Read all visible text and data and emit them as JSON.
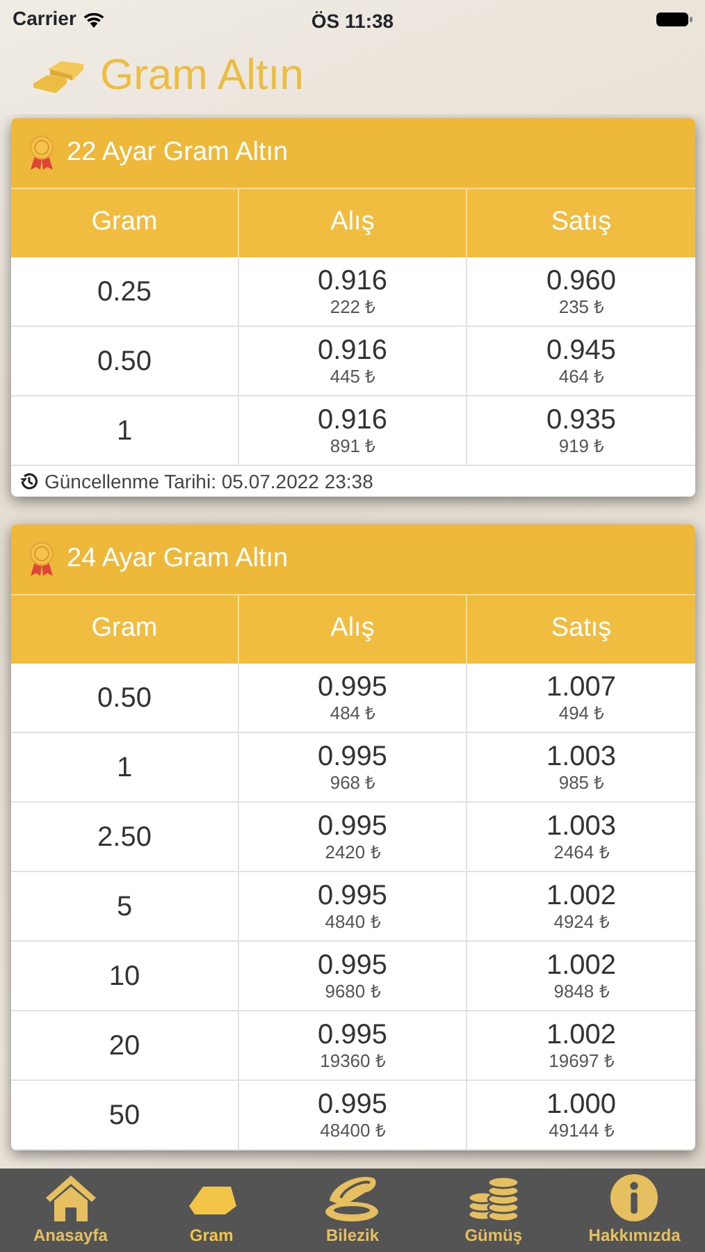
{
  "status_bar": {
    "carrier": "Carrier",
    "time": "ÖS 11:38"
  },
  "title": "Gram Altın",
  "tables": [
    {
      "title": "22 Ayar Gram Altın",
      "columns": [
        "Gram",
        "Alış",
        "Satış"
      ],
      "rows": [
        {
          "gram": "0.25",
          "buy": "0.916",
          "buy_price": "222 ₺",
          "sell": "0.960",
          "sell_price": "235 ₺"
        },
        {
          "gram": "0.50",
          "buy": "0.916",
          "buy_price": "445 ₺",
          "sell": "0.945",
          "sell_price": "464 ₺"
        },
        {
          "gram": "1",
          "buy": "0.916",
          "buy_price": "891 ₺",
          "sell": "0.935",
          "sell_price": "919 ₺"
        }
      ],
      "updated": "Güncellenme Tarihi: 05.07.2022 23:38"
    },
    {
      "title": "24 Ayar Gram Altın",
      "columns": [
        "Gram",
        "Alış",
        "Satış"
      ],
      "rows": [
        {
          "gram": "0.50",
          "buy": "0.995",
          "buy_price": "484 ₺",
          "sell": "1.007",
          "sell_price": "494 ₺"
        },
        {
          "gram": "1",
          "buy": "0.995",
          "buy_price": "968 ₺",
          "sell": "1.003",
          "sell_price": "985 ₺"
        },
        {
          "gram": "2.50",
          "buy": "0.995",
          "buy_price": "2420 ₺",
          "sell": "1.003",
          "sell_price": "2464 ₺"
        },
        {
          "gram": "5",
          "buy": "0.995",
          "buy_price": "4840 ₺",
          "sell": "1.002",
          "sell_price": "4924 ₺"
        },
        {
          "gram": "10",
          "buy": "0.995",
          "buy_price": "9680 ₺",
          "sell": "1.002",
          "sell_price": "9848 ₺"
        },
        {
          "gram": "20",
          "buy": "0.995",
          "buy_price": "19360 ₺",
          "sell": "1.002",
          "sell_price": "19697 ₺"
        },
        {
          "gram": "50",
          "buy": "0.995",
          "buy_price": "48400 ₺",
          "sell": "1.000",
          "sell_price": "49144 ₺"
        }
      ]
    }
  ],
  "tab_bar": [
    {
      "kind": "home",
      "label": "Anasayfa",
      "selected": false
    },
    {
      "kind": "bar",
      "label": "Gram",
      "selected": true
    },
    {
      "kind": "bracelet",
      "label": "Bilezik",
      "selected": false
    },
    {
      "kind": "coins",
      "label": "Gümüş",
      "selected": false
    },
    {
      "kind": "info",
      "label": "Hakkımızda",
      "selected": false
    }
  ]
}
